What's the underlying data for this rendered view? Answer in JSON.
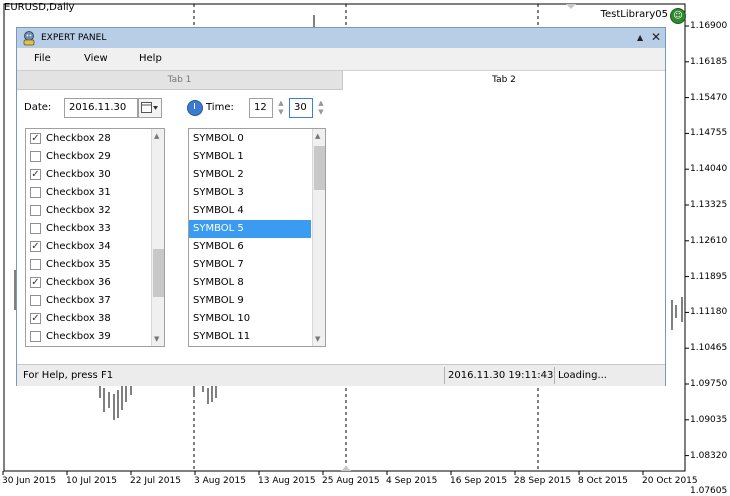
{
  "chart": {
    "symbol_label": "EURUSD,Daily",
    "library_label": "TestLibrary05",
    "smiley_icon": "smiley-icon",
    "price_labels": [
      "1.16900",
      "1.16185",
      "1.15470",
      "1.14755",
      "1.14040",
      "1.13325",
      "1.12610",
      "1.11895",
      "1.11180",
      "1.10465",
      "1.09750",
      "1.09035",
      "1.08320",
      "1.07605"
    ],
    "date_labels": [
      "30 Jun 2015",
      "10 Jul 2015",
      "22 Jul 2015",
      "3 Aug 2015",
      "13 Aug 2015",
      "25 Aug 2015",
      "4 Sep 2015",
      "16 Sep 2015",
      "28 Sep 2015",
      "8 Oct 2015",
      "20 Oct 2015"
    ]
  },
  "panel": {
    "title": "EXPERT PANEL",
    "title_icon": "robot-icon",
    "minimize_glyph": "▲",
    "close_glyph": "✕",
    "menu": [
      "File",
      "View",
      "Help"
    ],
    "tabs": [
      {
        "label": "Tab 1",
        "active": false
      },
      {
        "label": "Tab 2",
        "active": true
      }
    ],
    "date_label": "Date:",
    "date_value": "2016.11.30",
    "time_label": "Time:",
    "hour_value": "12",
    "minute_value": "30",
    "checkboxes": [
      {
        "label": "Checkbox 28",
        "checked": true
      },
      {
        "label": "Checkbox 29",
        "checked": false
      },
      {
        "label": "Checkbox 30",
        "checked": true
      },
      {
        "label": "Checkbox 31",
        "checked": false
      },
      {
        "label": "Checkbox 32",
        "checked": false
      },
      {
        "label": "Checkbox 33",
        "checked": false
      },
      {
        "label": "Checkbox 34",
        "checked": true
      },
      {
        "label": "Checkbox 35",
        "checked": false
      },
      {
        "label": "Checkbox 36",
        "checked": true
      },
      {
        "label": "Checkbox 37",
        "checked": false
      },
      {
        "label": "Checkbox 38",
        "checked": true
      },
      {
        "label": "Checkbox 39",
        "checked": false
      }
    ],
    "symbols": [
      "SYMBOL 0",
      "SYMBOL 1",
      "SYMBOL 2",
      "SYMBOL 3",
      "SYMBOL 4",
      "SYMBOL 5",
      "SYMBOL 6",
      "SYMBOL 7",
      "SYMBOL 8",
      "SYMBOL 9",
      "SYMBOL 10",
      "SYMBOL 11"
    ],
    "selected_symbol": "SYMBOL 5",
    "status": {
      "help": "For Help, press F1",
      "datetime": "2016.11.30 19:11:43",
      "state": "Loading..."
    },
    "colors": {
      "titlebar": "#b8cde6",
      "selection": "#3a9bf0"
    }
  }
}
